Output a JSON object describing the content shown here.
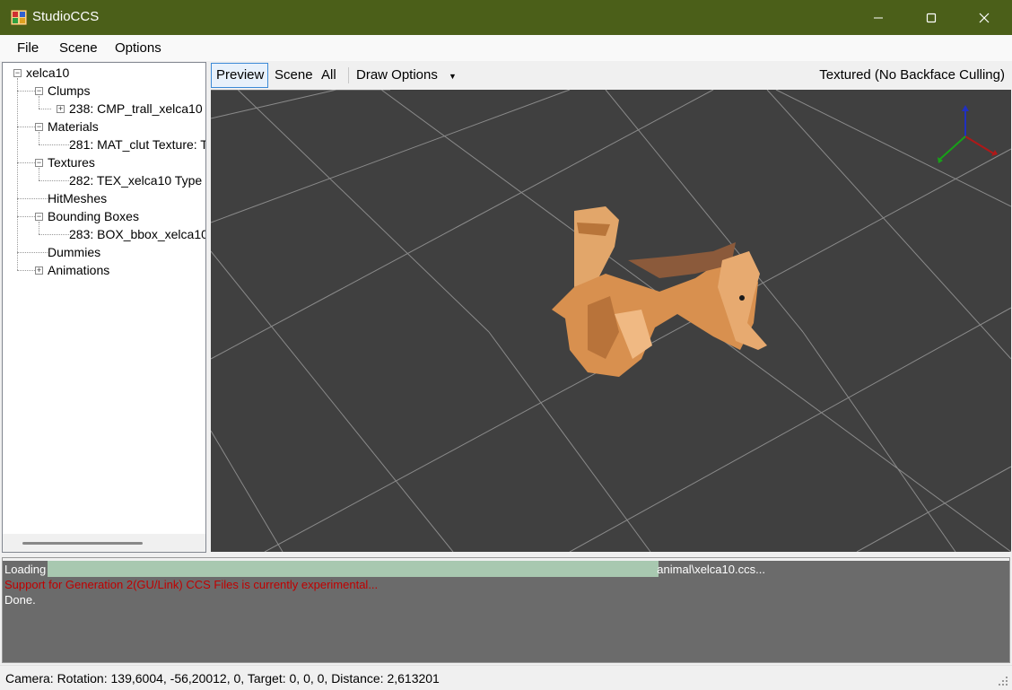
{
  "window": {
    "title": "StudioCCS",
    "accent": "#4b5f19"
  },
  "menu": {
    "items": [
      "File",
      "Scene",
      "Options"
    ]
  },
  "tree": {
    "root": "xelca10",
    "clumps": "Clumps",
    "clump_item": "238: CMP_trall_xelca10",
    "materials": "Materials",
    "material_item": "281: MAT_clut Texture: T",
    "textures": "Textures",
    "texture_item": "282: TEX_xelca10  Type",
    "hitmeshes": "HitMeshes",
    "bounding_boxes": "Bounding Boxes",
    "bbox_item": "283: BOX_bbox_xelca10",
    "dummies": "Dummies",
    "animations": "Animations"
  },
  "viewbar": {
    "tabs": [
      "Preview",
      "Scene",
      "All"
    ],
    "draw_options": "Draw Options",
    "mode": "Textured (No Backface Culling)"
  },
  "log": {
    "lines": [
      "Loading",
      "Support for Generation 2(GU/Link) CCS Files is currently experimental...",
      "Done."
    ],
    "path_suffix": "animal\\xelca10.ccs..."
  },
  "status": {
    "text": "Camera: Rotation: 139,6004, -56,20012, 0, Target: 0, 0, 0, Distance: 2,613201"
  }
}
